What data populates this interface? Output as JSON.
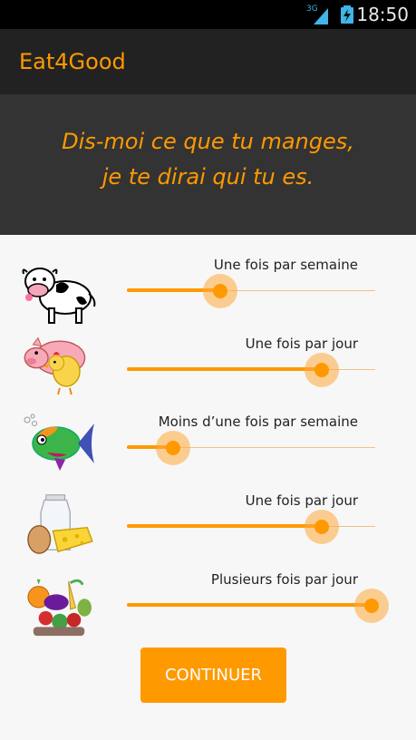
{
  "status": {
    "network": "3G",
    "time": "18:50"
  },
  "app": {
    "title": "Eat4Good"
  },
  "header": {
    "line1": "Dis-moi ce que tu manges,",
    "line2": "je te dirai qui tu es."
  },
  "rows": [
    {
      "label": "Une fois par semaine",
      "level": 0.39,
      "icon": "cow-icon"
    },
    {
      "label": "Une fois par jour",
      "level": 0.8,
      "icon": "pig-chicken-icon"
    },
    {
      "label": "Moins d’une fois par semaine",
      "level": 0.2,
      "icon": "fish-icon"
    },
    {
      "label": "Une fois par jour",
      "level": 0.8,
      "icon": "milk-egg-cheese-icon"
    },
    {
      "label": "Plusieurs fois par jour",
      "level": 1.0,
      "icon": "vegetables-icon"
    }
  ],
  "button": {
    "label": "CONTINUER"
  },
  "colors": {
    "accent": "#ff9900",
    "appbar": "#222222",
    "header": "#333333"
  }
}
